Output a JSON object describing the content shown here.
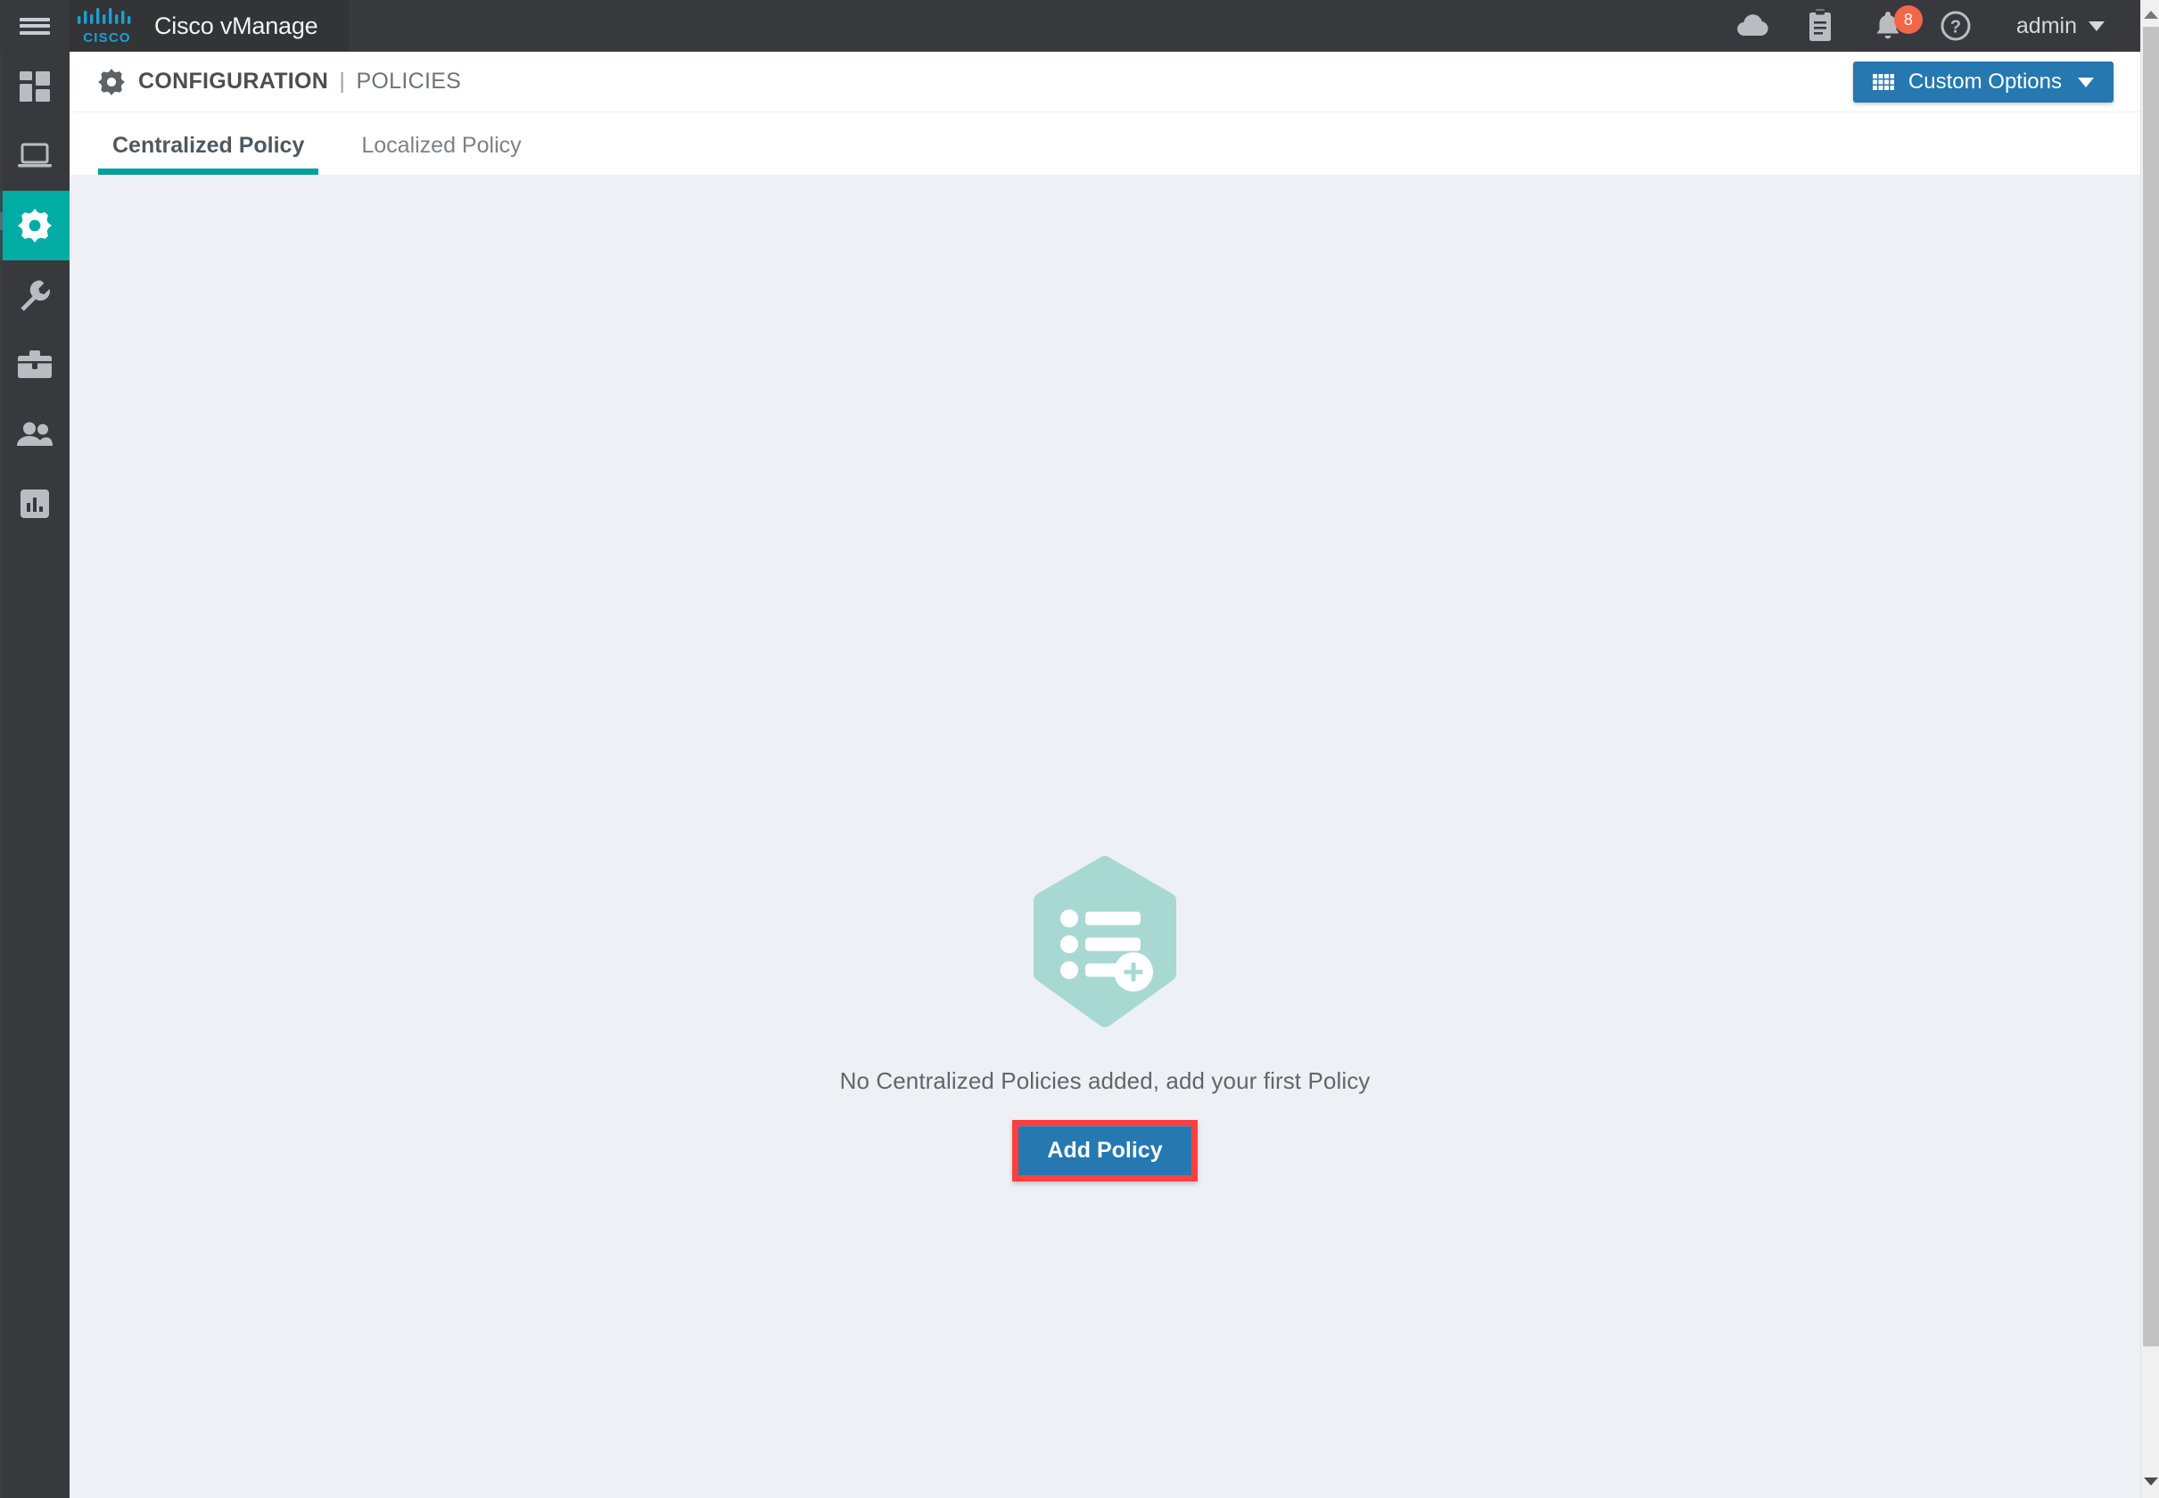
{
  "header": {
    "menu_icon": "hamburger-menu-icon",
    "brand_logo": "cisco-logo",
    "brand_title": "Cisco vManage",
    "icons": [
      {
        "name": "cloud-icon",
        "label": "Cloud"
      },
      {
        "name": "tasks-clipboard-icon",
        "label": "Tasks"
      },
      {
        "name": "alarm-bell-icon",
        "label": "Alarms",
        "badge": "8"
      },
      {
        "name": "help-circle-icon",
        "label": "Help"
      }
    ],
    "notification_badge": "8",
    "badge_color": "#f4664a",
    "user_label": "admin",
    "user_caret": "chevron-down-icon",
    "bar_color": "#37393c"
  },
  "sidebar": {
    "active_color": "#00aca4",
    "items": [
      {
        "name": "sidebar-item-dashboard",
        "icon": "dashboard-grid-icon",
        "active": false
      },
      {
        "name": "sidebar-item-monitor",
        "icon": "monitor-laptop-icon",
        "active": false
      },
      {
        "name": "sidebar-item-configuration",
        "icon": "gear-icon",
        "active": true
      },
      {
        "name": "sidebar-item-tools",
        "icon": "wrench-icon",
        "active": false
      },
      {
        "name": "sidebar-item-maintenance",
        "icon": "briefcase-icon",
        "active": false
      },
      {
        "name": "sidebar-item-administration",
        "icon": "people-icon",
        "active": false
      },
      {
        "name": "sidebar-item-analytics",
        "icon": "bar-chart-icon",
        "active": false
      }
    ]
  },
  "titlebar": {
    "icon": "gear-icon",
    "title": "CONFIGURATION",
    "separator": "|",
    "subtitle": "POLICIES",
    "custom_options_label": "Custom Options",
    "custom_options_icon": "grid-icon",
    "custom_options_caret": "chevron-down-icon",
    "button_color": "#2578b0"
  },
  "tabs": [
    {
      "label": "Centralized Policy",
      "active": true
    },
    {
      "label": "Localized Policy",
      "active": false
    }
  ],
  "tab_accent_color": "#00a098",
  "empty_state": {
    "illustration": "hexagon-policy-list-add-icon",
    "illustration_color": "#a8d8d2",
    "message": "No Centralized Policies added, add your first Policy",
    "add_button_label": "Add Policy",
    "highlight_color": "#fc4040"
  },
  "scrollbar": {
    "up_arrow": "scroll-up-arrow-icon",
    "down_arrow": "scroll-down-arrow-icon"
  }
}
